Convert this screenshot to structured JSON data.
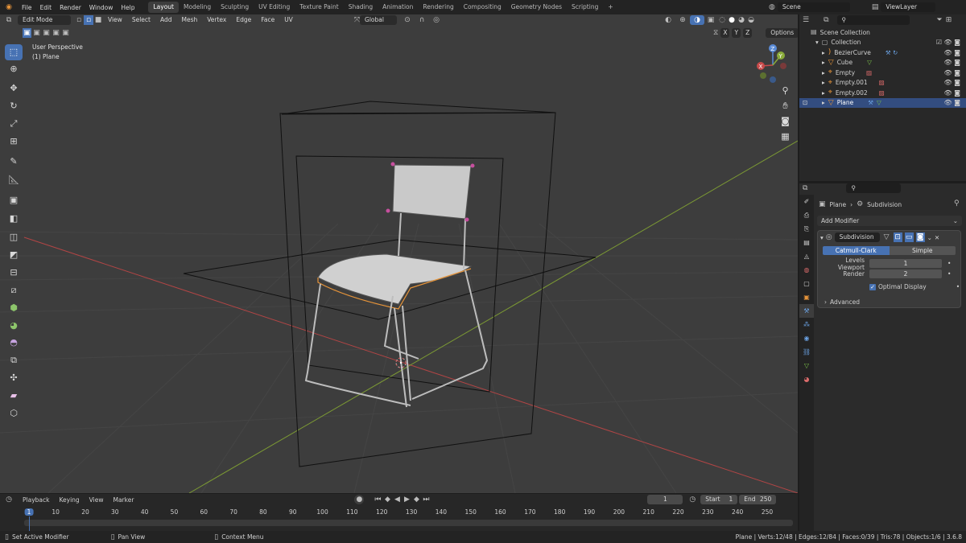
{
  "menu": [
    "File",
    "Edit",
    "Render",
    "Window",
    "Help"
  ],
  "workspaces": [
    "Layout",
    "Modeling",
    "Sculpting",
    "UV Editing",
    "Texture Paint",
    "Shading",
    "Animation",
    "Rendering",
    "Compositing",
    "Geometry Nodes",
    "Scripting",
    "+"
  ],
  "active_workspace": "Layout",
  "scene_name": "Scene",
  "view_layer": "ViewLayer",
  "viewport": {
    "mode": "Edit Mode",
    "menus": [
      "View",
      "Select",
      "Add",
      "Mesh",
      "Vertex",
      "Edge",
      "Face",
      "UV"
    ],
    "orientation": "Global",
    "axes": [
      "X",
      "Y",
      "Z"
    ],
    "options": "Options",
    "overlay_title": "User Perspective",
    "overlay_object": "(1) Plane"
  },
  "outliner": {
    "root": "Scene Collection",
    "collection": "Collection",
    "items": [
      "BezierCurve",
      "Cube",
      "Empty",
      "Empty.001",
      "Empty.002",
      "Plane"
    ],
    "selected": "Plane"
  },
  "properties": {
    "breadcrumb_object": "Plane",
    "breadcrumb_modifier": "Subdivision",
    "add_modifier": "Add Modifier",
    "modifier_name": "Subdivision",
    "tab_catmull": "Catmull-Clark",
    "tab_simple": "Simple",
    "levels_label": "Levels Viewport",
    "levels_value": "1",
    "render_label": "Render",
    "render_value": "2",
    "optimal_label": "Optimal Display",
    "advanced_label": "Advanced"
  },
  "timeline": {
    "menus": [
      "Playback",
      "Keying",
      "View",
      "Marker"
    ],
    "current_frame": "1",
    "start_label": "Start",
    "start_value": "1",
    "end_label": "End",
    "end_value": "250",
    "ticks": [
      "1",
      "10",
      "20",
      "30",
      "40",
      "50",
      "60",
      "70",
      "80",
      "90",
      "100",
      "110",
      "120",
      "130",
      "140",
      "150",
      "160",
      "170",
      "180",
      "190",
      "200",
      "210",
      "220",
      "230",
      "240",
      "250"
    ]
  },
  "status": {
    "left_action": "Set Active Modifier",
    "mid_action": "Pan View",
    "right_action": "Context Menu",
    "stats": "Plane | Verts:12/48 | Edges:12/84 | Faces:0/39 | Tris:78 | Objects:1/6 | 3.6.8"
  },
  "colors": {
    "accent": "#4772b3",
    "x_axis": "#c84a4a",
    "y_axis": "#8aab3a",
    "selected_edge": "#e6943a"
  }
}
